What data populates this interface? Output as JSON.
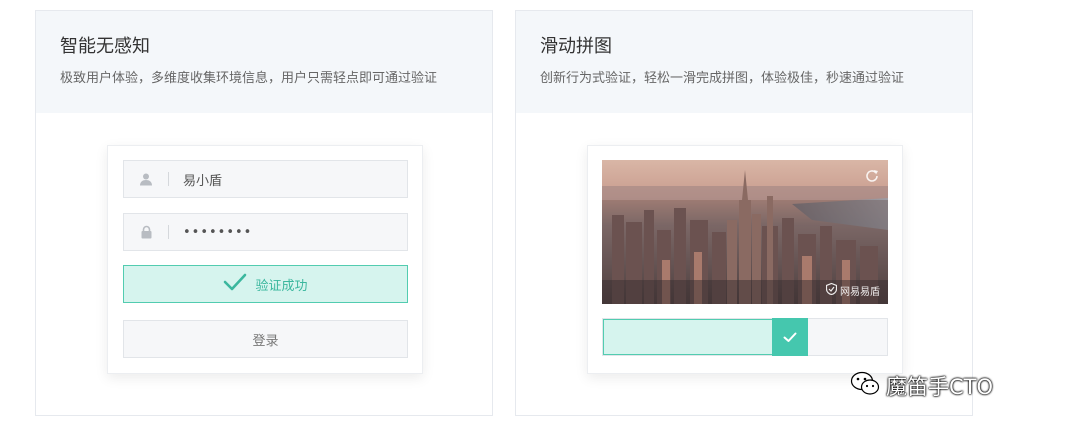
{
  "left_card": {
    "title": "智能无感知",
    "description": "极致用户体验，多维度收集环境信息，用户只需轻点即可通过验证",
    "username_value": "易小盾",
    "password_mask": "••••••••",
    "verify_success_label": "验证成功",
    "login_label": "登录",
    "icons": [
      "user-icon",
      "lock-icon",
      "check-icon"
    ],
    "accent_color": "#52ccb0"
  },
  "right_card": {
    "title": "滑动拼图",
    "description": "创新行为式验证，轻松一滑完成拼图，体验极佳，秒速通过验证",
    "brand_mark": "网易易盾",
    "slider_progress": 0.68,
    "icons": [
      "refresh-icon",
      "shield-icon",
      "check-icon"
    ],
    "accent_color": "#45c7ae"
  },
  "watermark": {
    "text": "魔笛手CTO",
    "icon": "wechat-icon"
  }
}
